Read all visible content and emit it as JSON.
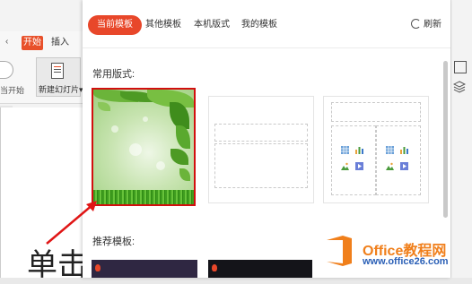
{
  "behind": {
    "tab_home": "开始",
    "tab_insert": "插入",
    "start_label": "当开始",
    "new_slide_label": "新建幻灯片"
  },
  "panel": {
    "tabs": [
      "当前模板",
      "其他模板",
      "本机版式",
      "我的模板"
    ],
    "refresh_label": "刷新",
    "section_common": "常用版式:",
    "section_recommended": "推荐模板:"
  },
  "watermark": {
    "title": "Office教程网",
    "url": "www.office26.com"
  },
  "colors": {
    "accent": "#e8472a",
    "selection": "#d20f0f"
  }
}
